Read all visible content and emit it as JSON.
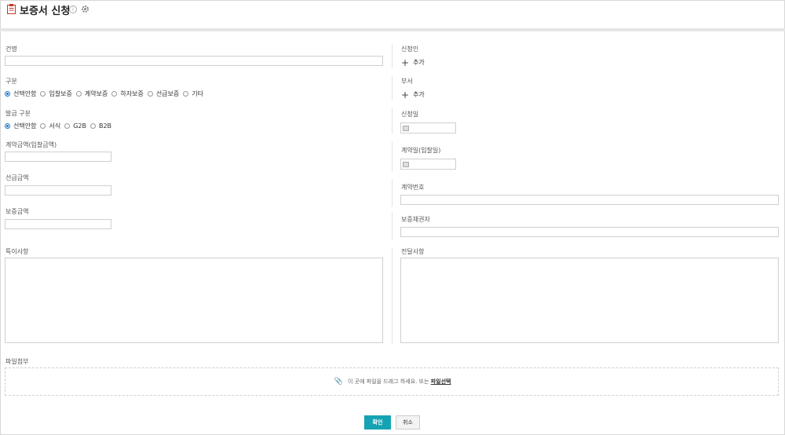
{
  "header": {
    "title": "보증서 신청"
  },
  "left": {
    "subject_label": "건명",
    "category_label": "구분",
    "category_options": [
      "선택안함",
      "입찰보증",
      "계약보증",
      "하자보증",
      "선급보증",
      "기타"
    ],
    "category_selected": "선택안함",
    "issue_type_label": "발급 구분",
    "issue_type_options": [
      "선택안함",
      "서식",
      "G2B",
      "B2B"
    ],
    "issue_type_selected": "선택안함",
    "contract_amount_label": "계약금액(입찰금액)",
    "advance_amount_label": "선급금액",
    "guarantee_amount_label": "보증금액",
    "remarks_label": "특이사항"
  },
  "right": {
    "applicant_label": "신청인",
    "applicant_add": "추가",
    "department_label": "부서",
    "department_add": "추가",
    "apply_date_label": "신청일",
    "contract_date_label": "계약일(입찰일)",
    "contract_no_label": "계약번호",
    "obligee_label": "보증채권자",
    "message_label": "전달사항"
  },
  "attachment": {
    "label": "파일첨부",
    "drop_text": "이 곳에 파일을 드래그 하세요. 또는",
    "select_link": "파일선택"
  },
  "buttons": {
    "confirm": "확인",
    "cancel": "취소"
  },
  "colors": {
    "primary": "#15a3b4",
    "radio_checked": "#1a73c9"
  }
}
